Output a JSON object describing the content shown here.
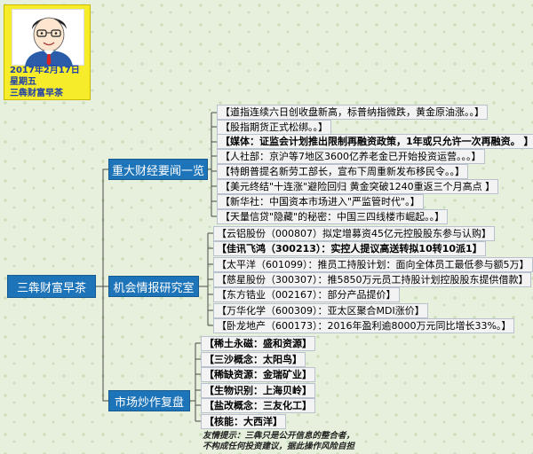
{
  "card": {
    "date": "2017年2月17日",
    "weekday": "星期五",
    "name": "三犇财富早茶"
  },
  "root": {
    "label": "三犇财富早茶"
  },
  "branches": [
    {
      "label": "重大财经要闻一览",
      "items": [
        "【道指连续六日创收盘新高，标普纳指微跌，黄金原油涨。。】",
        "【股指期货正式松绑。。】",
        "【媒体：证监会计划推出限制再融资政策，1年或只允许一次再融资。 】",
        "【人社部：京沪等7地区3600亿养老金已开始投资运营。。。】",
        "【特朗普提名新劳工部长，宣布下周重新发布移民令。。】",
        "【美元终结\"十连涨\"避险回归 黄金突破1240重返三个月高点 】",
        "【新华社：中国资本市场进入\"严监管时代\"。】",
        "【天量信贷\"隐藏\"的秘密：中国三四线楼市崛起。。】"
      ]
    },
    {
      "label": "机会情报研究室",
      "items": [
        "【云铝股份（000807）拟定增募资45亿元控股股东参与认购】",
        "【佳讯飞鸿（300213）：实控人提议高送转拟10转10派1】",
        "【太平洋（601099）：推员工持股计划：面向全体员工最低参与额5万】",
        "【慈星股份（300307）：推5850万元员工持股计划控股股东提供借款】",
        "【东方锆业（002167）：部分产品提价】",
        "【万华化学（600309）：亚太区聚合MDI涨价】",
        "【卧龙地产（600173）：2016年盈利逾8000万元同比增长33%。】"
      ]
    },
    {
      "label": "市场炒作复盘",
      "items": [
        "【稀土永磁：盛和资源】",
        "【三沙概念：太阳鸟】",
        "【稀缺资源：金瑞矿业】",
        "【生物识别：上海贝岭】",
        "【盐改概念：三友化工】",
        "【核能：大西洋】"
      ]
    }
  ],
  "disclaimer": {
    "line1": "友情提示：三犇只是公开信息的整合者，",
    "line2": "不构成任何投资建议，据此操作风险自担"
  },
  "colors": {
    "branch_fill": "#1e74b8",
    "card_fill": "#f6ec2a",
    "card_text": "#1f3fa8",
    "leaf_fill": "#f3f3f3",
    "connector": "#4a4a4a"
  }
}
